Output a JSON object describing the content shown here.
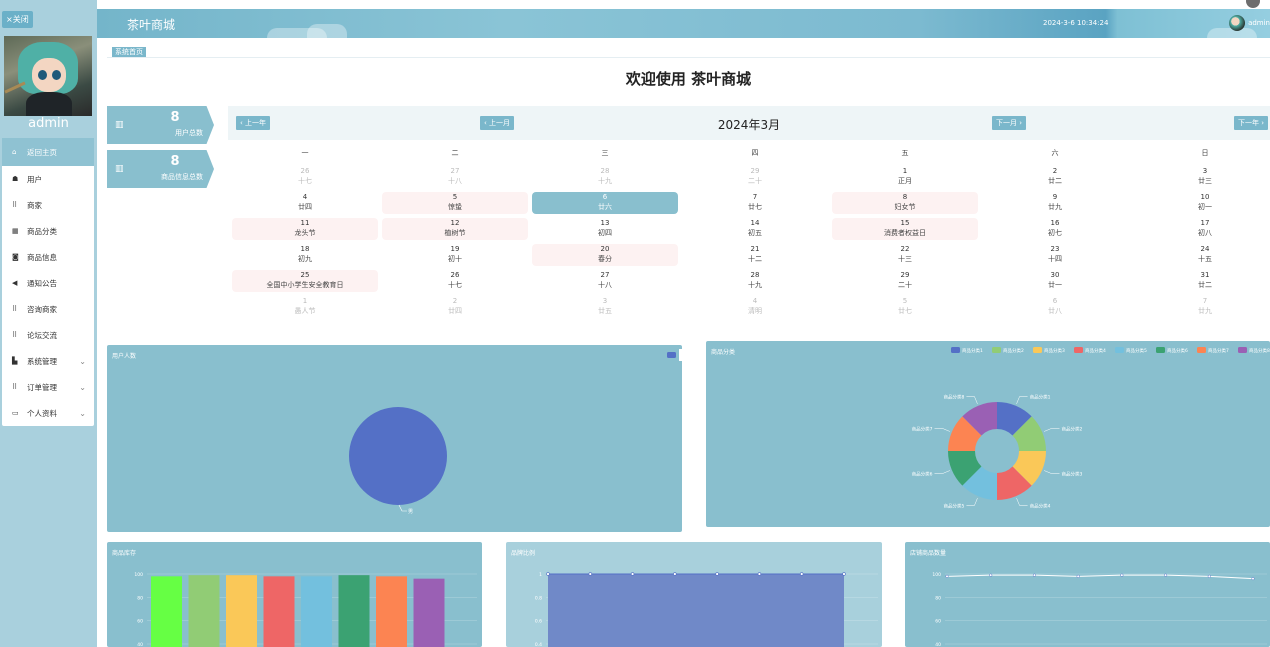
{
  "sidebar": {
    "close_label": "×关闭",
    "user_name": "admin",
    "items": [
      {
        "icon": "home-icon",
        "glyph": "⌂",
        "label": "返回主页",
        "chevron": false
      },
      {
        "icon": "user-icon",
        "glyph": "☗",
        "label": "用户",
        "chevron": false
      },
      {
        "icon": "grid-icon",
        "glyph": "⠿",
        "label": "商家",
        "chevron": false
      },
      {
        "icon": "table-icon",
        "glyph": "▦",
        "label": "商品分类",
        "chevron": false
      },
      {
        "icon": "doc-icon",
        "glyph": "◙",
        "label": "商品信息",
        "chevron": false
      },
      {
        "icon": "megaphone-icon",
        "glyph": "◀",
        "label": "通知公告",
        "chevron": false
      },
      {
        "icon": "grid-icon",
        "glyph": "⠿",
        "label": "咨询商家",
        "chevron": false
      },
      {
        "icon": "grid-icon",
        "glyph": "⠿",
        "label": "论坛交流",
        "chevron": false
      },
      {
        "icon": "chart-icon",
        "glyph": "▙",
        "label": "系统管理",
        "chevron": true
      },
      {
        "icon": "grid-icon",
        "glyph": "⠿",
        "label": "订单管理",
        "chevron": true
      },
      {
        "icon": "card-icon",
        "glyph": "▭",
        "label": "个人资料",
        "chevron": true
      }
    ]
  },
  "header": {
    "title": "茶叶商城",
    "datetime": "2024-3-6 10:34:24",
    "user": "admin"
  },
  "breadcrumb": "系统首页",
  "welcome": "欢迎使用 茶叶商城",
  "stats": [
    {
      "value": "8",
      "label": "用户总数"
    },
    {
      "value": "8",
      "label": "商品信息总数"
    }
  ],
  "calendar": {
    "title": "2024年3月",
    "prev_year": "上一年",
    "prev_month": "上一月",
    "next_month": "下一月",
    "next_year": "下一年",
    "weekdays": [
      "一",
      "二",
      "三",
      "四",
      "五",
      "六",
      "日"
    ],
    "weeks": [
      [
        {
          "n": "26",
          "l": "十七",
          "muted": true
        },
        {
          "n": "27",
          "l": "十八",
          "muted": true
        },
        {
          "n": "28",
          "l": "十九",
          "muted": true
        },
        {
          "n": "29",
          "l": "二十",
          "muted": true
        },
        {
          "n": "1",
          "l": "正月"
        },
        {
          "n": "2",
          "l": "廿二"
        },
        {
          "n": "3",
          "l": "廿三"
        }
      ],
      [
        {
          "n": "4",
          "l": "廿四"
        },
        {
          "n": "5",
          "l": "惊蛰",
          "hl": true
        },
        {
          "n": "6",
          "l": "廿六",
          "today": true
        },
        {
          "n": "7",
          "l": "廿七"
        },
        {
          "n": "8",
          "l": "妇女节",
          "hl": true
        },
        {
          "n": "9",
          "l": "廿九"
        },
        {
          "n": "10",
          "l": "初一"
        }
      ],
      [
        {
          "n": "11",
          "l": "龙头节",
          "hl": true
        },
        {
          "n": "12",
          "l": "植树节",
          "hl": true
        },
        {
          "n": "13",
          "l": "初四"
        },
        {
          "n": "14",
          "l": "初五"
        },
        {
          "n": "15",
          "l": "消费者权益日",
          "hl": true
        },
        {
          "n": "16",
          "l": "初七"
        },
        {
          "n": "17",
          "l": "初八"
        }
      ],
      [
        {
          "n": "18",
          "l": "初九"
        },
        {
          "n": "19",
          "l": "初十"
        },
        {
          "n": "20",
          "l": "春分",
          "hl": true
        },
        {
          "n": "21",
          "l": "十二"
        },
        {
          "n": "22",
          "l": "十三"
        },
        {
          "n": "23",
          "l": "十四"
        },
        {
          "n": "24",
          "l": "十五"
        }
      ],
      [
        {
          "n": "25",
          "l": "全国中小学生安全教育日",
          "hl": true
        },
        {
          "n": "26",
          "l": "十七"
        },
        {
          "n": "27",
          "l": "十八"
        },
        {
          "n": "28",
          "l": "十九"
        },
        {
          "n": "29",
          "l": "二十"
        },
        {
          "n": "30",
          "l": "廿一"
        },
        {
          "n": "31",
          "l": "廿二"
        }
      ],
      [
        {
          "n": "1",
          "l": "愚人节",
          "muted": true
        },
        {
          "n": "2",
          "l": "廿四",
          "muted": true
        },
        {
          "n": "3",
          "l": "廿五",
          "muted": true
        },
        {
          "n": "4",
          "l": "清明",
          "muted": true
        },
        {
          "n": "5",
          "l": "廿七",
          "muted": true
        },
        {
          "n": "6",
          "l": "廿八",
          "muted": true
        },
        {
          "n": "7",
          "l": "廿九",
          "muted": true
        }
      ]
    ]
  },
  "chart_data": [
    {
      "type": "pie",
      "title": "用户人数",
      "categories": [
        "男"
      ],
      "values": [
        8
      ],
      "colors": [
        "#5470c6"
      ]
    },
    {
      "type": "pie",
      "title": "商品分类",
      "categories": [
        "商品分类1",
        "商品分类2",
        "商品分类3",
        "商品分类4",
        "商品分类5",
        "商品分类6",
        "商品分类7",
        "商品分类8"
      ],
      "values": [
        1,
        1,
        1,
        1,
        1,
        1,
        1,
        1
      ],
      "colors": [
        "#5470c6",
        "#91cc75",
        "#fac858",
        "#ee6666",
        "#73c0de",
        "#3ba272",
        "#fc8452",
        "#9a60b4"
      ],
      "legend": "top-right"
    },
    {
      "type": "bar",
      "title": "商品库存",
      "values": [
        98,
        99,
        99,
        98,
        98,
        99,
        98,
        96
      ],
      "colors": [
        "#66ff44",
        "#91cc75",
        "#fac858",
        "#ee6666",
        "#73c0de",
        "#3ba272",
        "#fc8452",
        "#9a60b4"
      ],
      "ylim": [
        40,
        100
      ],
      "yticks": [
        "100",
        "80",
        "60",
        "40"
      ]
    },
    {
      "type": "area",
      "title": "品牌比例",
      "values": [
        1,
        1,
        1,
        1,
        1,
        1,
        1,
        1
      ],
      "ylim": [
        0.4,
        1
      ],
      "yticks": [
        "1",
        "0.8",
        "0.6",
        "0.4"
      ],
      "color": "#7089c8"
    },
    {
      "type": "line",
      "title": "店铺商品数量",
      "values": [
        98,
        99,
        99,
        98,
        99,
        99,
        98,
        96
      ],
      "ylim": [
        40,
        100
      ],
      "yticks": [
        "100",
        "80",
        "60",
        "40"
      ],
      "color": "#ffffff"
    }
  ]
}
